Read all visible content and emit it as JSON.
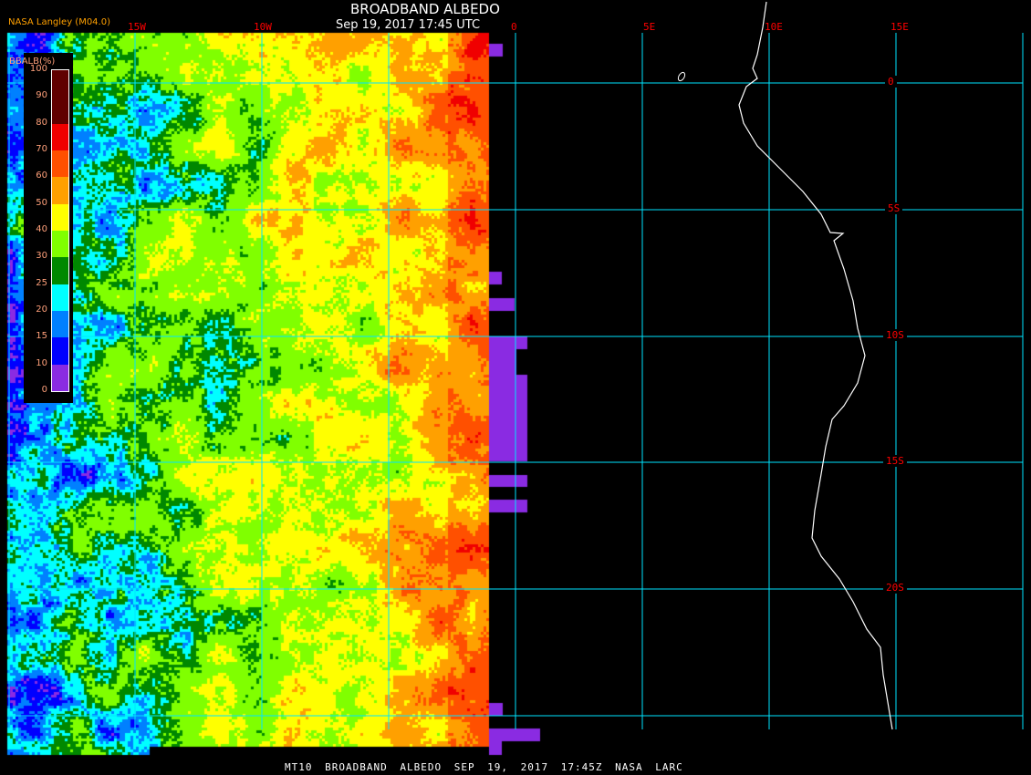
{
  "header": {
    "title": "BROADBAND ALBEDO",
    "subtitle": "Sep 19, 2017 17:45 UTC",
    "credit": "NASA Langley (M04.0)"
  },
  "footer": "MT10  BROADBAND ALBEDO  SEP 19, 2017 17:45Z  NASA LARC",
  "longitude_labels": [
    "15W",
    "10W",
    "0",
    "5E",
    "10E",
    "15E"
  ],
  "latitude_labels": [
    "0",
    "5S",
    "10S",
    "15S",
    "20S"
  ],
  "legend": {
    "title": "BBALB(%)",
    "ticks": [
      "100",
      "90",
      "80",
      "70",
      "60",
      "50",
      "40",
      "30",
      "25",
      "20",
      "15",
      "10",
      "0"
    ],
    "colors": [
      "#600000",
      "#600000",
      "#f00000",
      "#ff5000",
      "#ffa000",
      "#ffff00",
      "#80ff00",
      "#008800",
      "#00ffff",
      "#0080ff",
      "#0000ff",
      "#8a2be2"
    ]
  },
  "colors": {
    "grid": "#00e5ff",
    "coast": "#ffffff",
    "missing": "#8a2be2"
  }
}
